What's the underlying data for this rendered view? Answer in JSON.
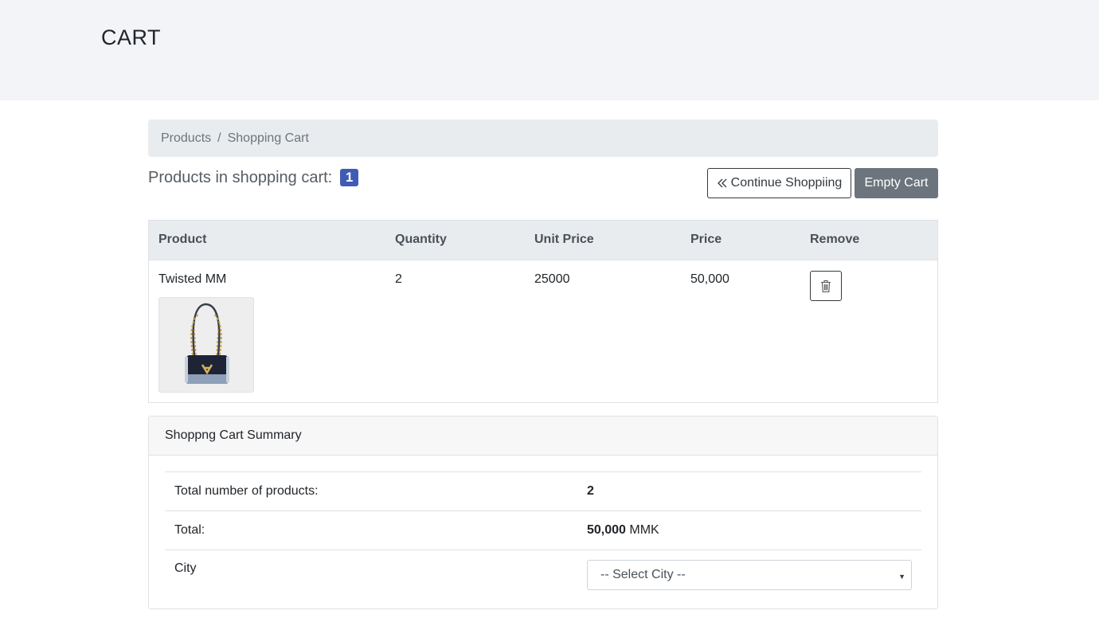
{
  "header": {
    "title": "CART"
  },
  "breadcrumb": {
    "items": [
      "Products",
      "Shopping Cart"
    ],
    "separator": "/"
  },
  "cart_summary_bar": {
    "label": "Products in shopping cart:",
    "count": "1",
    "continue_label": "Continue Shoppiing",
    "empty_label": "Empty Cart"
  },
  "table": {
    "headers": [
      "Product",
      "Quantity",
      "Unit Price",
      "Price",
      "Remove"
    ],
    "rows": [
      {
        "product": "Twisted MM",
        "quantity": "2",
        "unit_price": "25000",
        "price": "50,000",
        "image_icon": "handbag-image",
        "remove_icon": "trash-icon"
      }
    ]
  },
  "summary": {
    "title": "Shoppng Cart Summary",
    "total_products_label": "Total number of products:",
    "total_products_value": "2",
    "total_label": "Total:",
    "total_value": "50,000",
    "currency": "MMK",
    "city_label": "City",
    "city_placeholder": "-- Select City --"
  },
  "colors": {
    "badge": "#3f5bb5",
    "empty_button": "#6c757d",
    "hero_bg": "#f2f4f7"
  }
}
